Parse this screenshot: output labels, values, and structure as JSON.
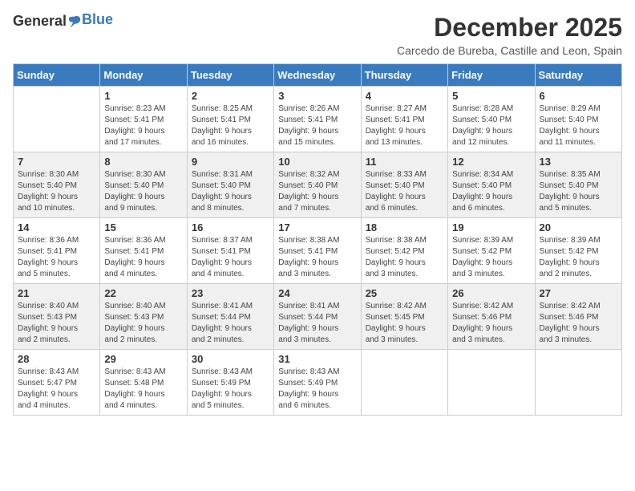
{
  "header": {
    "logo_general": "General",
    "logo_blue": "Blue",
    "month_title": "December 2025",
    "location": "Carcedo de Bureba, Castille and Leon, Spain"
  },
  "calendar": {
    "days_of_week": [
      "Sunday",
      "Monday",
      "Tuesday",
      "Wednesday",
      "Thursday",
      "Friday",
      "Saturday"
    ],
    "weeks": [
      [
        {
          "day": "",
          "info": ""
        },
        {
          "day": "1",
          "info": "Sunrise: 8:23 AM\nSunset: 5:41 PM\nDaylight: 9 hours\nand 17 minutes."
        },
        {
          "day": "2",
          "info": "Sunrise: 8:25 AM\nSunset: 5:41 PM\nDaylight: 9 hours\nand 16 minutes."
        },
        {
          "day": "3",
          "info": "Sunrise: 8:26 AM\nSunset: 5:41 PM\nDaylight: 9 hours\nand 15 minutes."
        },
        {
          "day": "4",
          "info": "Sunrise: 8:27 AM\nSunset: 5:41 PM\nDaylight: 9 hours\nand 13 minutes."
        },
        {
          "day": "5",
          "info": "Sunrise: 8:28 AM\nSunset: 5:40 PM\nDaylight: 9 hours\nand 12 minutes."
        },
        {
          "day": "6",
          "info": "Sunrise: 8:29 AM\nSunset: 5:40 PM\nDaylight: 9 hours\nand 11 minutes."
        }
      ],
      [
        {
          "day": "7",
          "info": "Sunrise: 8:30 AM\nSunset: 5:40 PM\nDaylight: 9 hours\nand 10 minutes."
        },
        {
          "day": "8",
          "info": "Sunrise: 8:30 AM\nSunset: 5:40 PM\nDaylight: 9 hours\nand 9 minutes."
        },
        {
          "day": "9",
          "info": "Sunrise: 8:31 AM\nSunset: 5:40 PM\nDaylight: 9 hours\nand 8 minutes."
        },
        {
          "day": "10",
          "info": "Sunrise: 8:32 AM\nSunset: 5:40 PM\nDaylight: 9 hours\nand 7 minutes."
        },
        {
          "day": "11",
          "info": "Sunrise: 8:33 AM\nSunset: 5:40 PM\nDaylight: 9 hours\nand 6 minutes."
        },
        {
          "day": "12",
          "info": "Sunrise: 8:34 AM\nSunset: 5:40 PM\nDaylight: 9 hours\nand 6 minutes."
        },
        {
          "day": "13",
          "info": "Sunrise: 8:35 AM\nSunset: 5:40 PM\nDaylight: 9 hours\nand 5 minutes."
        }
      ],
      [
        {
          "day": "14",
          "info": "Sunrise: 8:36 AM\nSunset: 5:41 PM\nDaylight: 9 hours\nand 5 minutes."
        },
        {
          "day": "15",
          "info": "Sunrise: 8:36 AM\nSunset: 5:41 PM\nDaylight: 9 hours\nand 4 minutes."
        },
        {
          "day": "16",
          "info": "Sunrise: 8:37 AM\nSunset: 5:41 PM\nDaylight: 9 hours\nand 4 minutes."
        },
        {
          "day": "17",
          "info": "Sunrise: 8:38 AM\nSunset: 5:41 PM\nDaylight: 9 hours\nand 3 minutes."
        },
        {
          "day": "18",
          "info": "Sunrise: 8:38 AM\nSunset: 5:42 PM\nDaylight: 9 hours\nand 3 minutes."
        },
        {
          "day": "19",
          "info": "Sunrise: 8:39 AM\nSunset: 5:42 PM\nDaylight: 9 hours\nand 3 minutes."
        },
        {
          "day": "20",
          "info": "Sunrise: 8:39 AM\nSunset: 5:42 PM\nDaylight: 9 hours\nand 2 minutes."
        }
      ],
      [
        {
          "day": "21",
          "info": "Sunrise: 8:40 AM\nSunset: 5:43 PM\nDaylight: 9 hours\nand 2 minutes."
        },
        {
          "day": "22",
          "info": "Sunrise: 8:40 AM\nSunset: 5:43 PM\nDaylight: 9 hours\nand 2 minutes."
        },
        {
          "day": "23",
          "info": "Sunrise: 8:41 AM\nSunset: 5:44 PM\nDaylight: 9 hours\nand 2 minutes."
        },
        {
          "day": "24",
          "info": "Sunrise: 8:41 AM\nSunset: 5:44 PM\nDaylight: 9 hours\nand 3 minutes."
        },
        {
          "day": "25",
          "info": "Sunrise: 8:42 AM\nSunset: 5:45 PM\nDaylight: 9 hours\nand 3 minutes."
        },
        {
          "day": "26",
          "info": "Sunrise: 8:42 AM\nSunset: 5:46 PM\nDaylight: 9 hours\nand 3 minutes."
        },
        {
          "day": "27",
          "info": "Sunrise: 8:42 AM\nSunset: 5:46 PM\nDaylight: 9 hours\nand 3 minutes."
        }
      ],
      [
        {
          "day": "28",
          "info": "Sunrise: 8:43 AM\nSunset: 5:47 PM\nDaylight: 9 hours\nand 4 minutes."
        },
        {
          "day": "29",
          "info": "Sunrise: 8:43 AM\nSunset: 5:48 PM\nDaylight: 9 hours\nand 4 minutes."
        },
        {
          "day": "30",
          "info": "Sunrise: 8:43 AM\nSunset: 5:49 PM\nDaylight: 9 hours\nand 5 minutes."
        },
        {
          "day": "31",
          "info": "Sunrise: 8:43 AM\nSunset: 5:49 PM\nDaylight: 9 hours\nand 6 minutes."
        },
        {
          "day": "",
          "info": ""
        },
        {
          "day": "",
          "info": ""
        },
        {
          "day": "",
          "info": ""
        }
      ]
    ]
  }
}
